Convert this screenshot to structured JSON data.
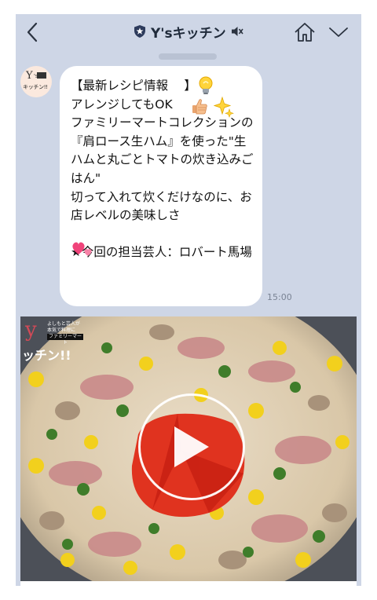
{
  "header": {
    "title": "Y'sキッチン"
  },
  "avatar": {
    "logo_letter": "Y",
    "logo_s": "'s",
    "logo_text": "キッチン!!"
  },
  "message": {
    "text": "【最新レシピ情報 　】\nアレンジしてもOK 　 　\nファミリーマートコレクションの『肩ロース生ハム』を使った\"生ハムと丸ごとトマトの炊き込みごはん\"\n切って入れて炊くだけなのに、お店レベルの美味しさ\n　\n★今回の担当芸人：ロバート馬場",
    "time": "15:00"
  },
  "media": {
    "watermark_letter": "y",
    "watermark_small": "よしもと芸人が\n本気で料理に",
    "watermark_box": "ファミリーマート",
    "watermark_kana": "ッチン!!"
  },
  "icons": {
    "back": "chevron-left-icon",
    "shield": "shield-star-icon",
    "mute": "speaker-mute-icon",
    "home": "home-icon",
    "menu": "chevron-down-icon",
    "bulb": "lightbulb-icon",
    "thumb": "thumbs-up-icon",
    "sparkle": "sparkle-icon",
    "hearts": "two-hearts-icon",
    "play": "play-icon"
  },
  "colors": {
    "chat_bg": "#ced6e6",
    "bubble": "#ffffff",
    "text": "#111111"
  }
}
